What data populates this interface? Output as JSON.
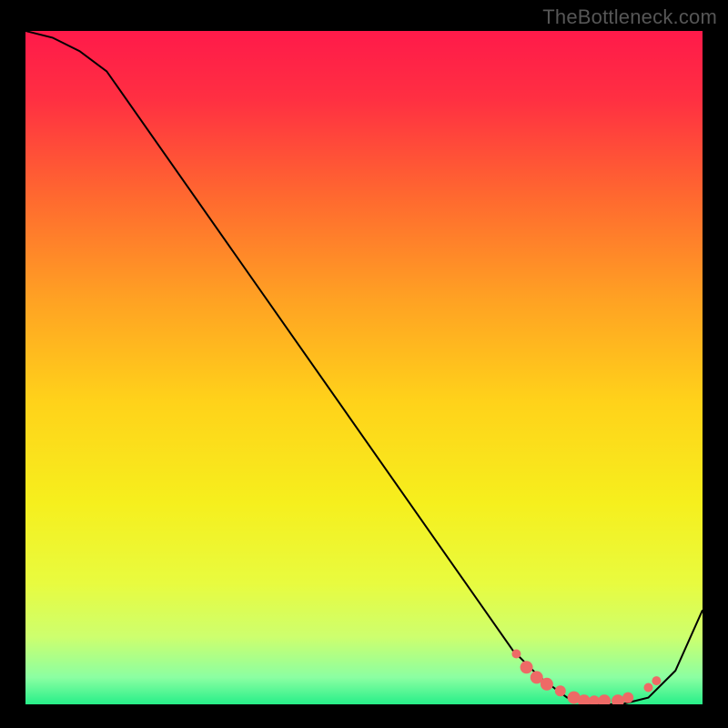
{
  "attribution": "TheBottleneck.com",
  "chart_data": {
    "type": "line",
    "title": "",
    "xlabel": "",
    "ylabel": "",
    "xlim": [
      0,
      100
    ],
    "ylim": [
      0,
      100
    ],
    "grid": false,
    "background_gradient": [
      {
        "pos": 0.0,
        "color": "#ff1a4a"
      },
      {
        "pos": 0.1,
        "color": "#ff2f42"
      },
      {
        "pos": 0.25,
        "color": "#ff6a2f"
      },
      {
        "pos": 0.4,
        "color": "#ffa223"
      },
      {
        "pos": 0.55,
        "color": "#ffd21a"
      },
      {
        "pos": 0.7,
        "color": "#f6ef1d"
      },
      {
        "pos": 0.82,
        "color": "#e8fb3f"
      },
      {
        "pos": 0.9,
        "color": "#cdff6e"
      },
      {
        "pos": 0.96,
        "color": "#8bffa2"
      },
      {
        "pos": 1.0,
        "color": "#27ef89"
      }
    ],
    "series": [
      {
        "name": "curve",
        "color": "#000000",
        "stroke_width": 2,
        "x": [
          0,
          4,
          8,
          12,
          72,
          76,
          80,
          84,
          88,
          92,
          96,
          100
        ],
        "y": [
          100,
          99,
          97,
          94,
          8,
          4,
          1,
          0,
          0,
          1,
          5,
          14
        ]
      }
    ],
    "markers": {
      "name": "dots",
      "color": "#ee6a66",
      "points": [
        {
          "x": 72.5,
          "y": 7.5,
          "r": 5
        },
        {
          "x": 74.0,
          "y": 5.5,
          "r": 7
        },
        {
          "x": 75.5,
          "y": 4.0,
          "r": 7
        },
        {
          "x": 77.0,
          "y": 3.0,
          "r": 7
        },
        {
          "x": 79.0,
          "y": 2.0,
          "r": 6
        },
        {
          "x": 81.0,
          "y": 1.0,
          "r": 7
        },
        {
          "x": 82.5,
          "y": 0.5,
          "r": 7
        },
        {
          "x": 84.0,
          "y": 0.5,
          "r": 6
        },
        {
          "x": 85.5,
          "y": 0.5,
          "r": 7
        },
        {
          "x": 87.5,
          "y": 0.5,
          "r": 7
        },
        {
          "x": 89.0,
          "y": 1.0,
          "r": 6
        },
        {
          "x": 92.0,
          "y": 2.5,
          "r": 5
        },
        {
          "x": 93.2,
          "y": 3.5,
          "r": 5
        }
      ]
    }
  }
}
